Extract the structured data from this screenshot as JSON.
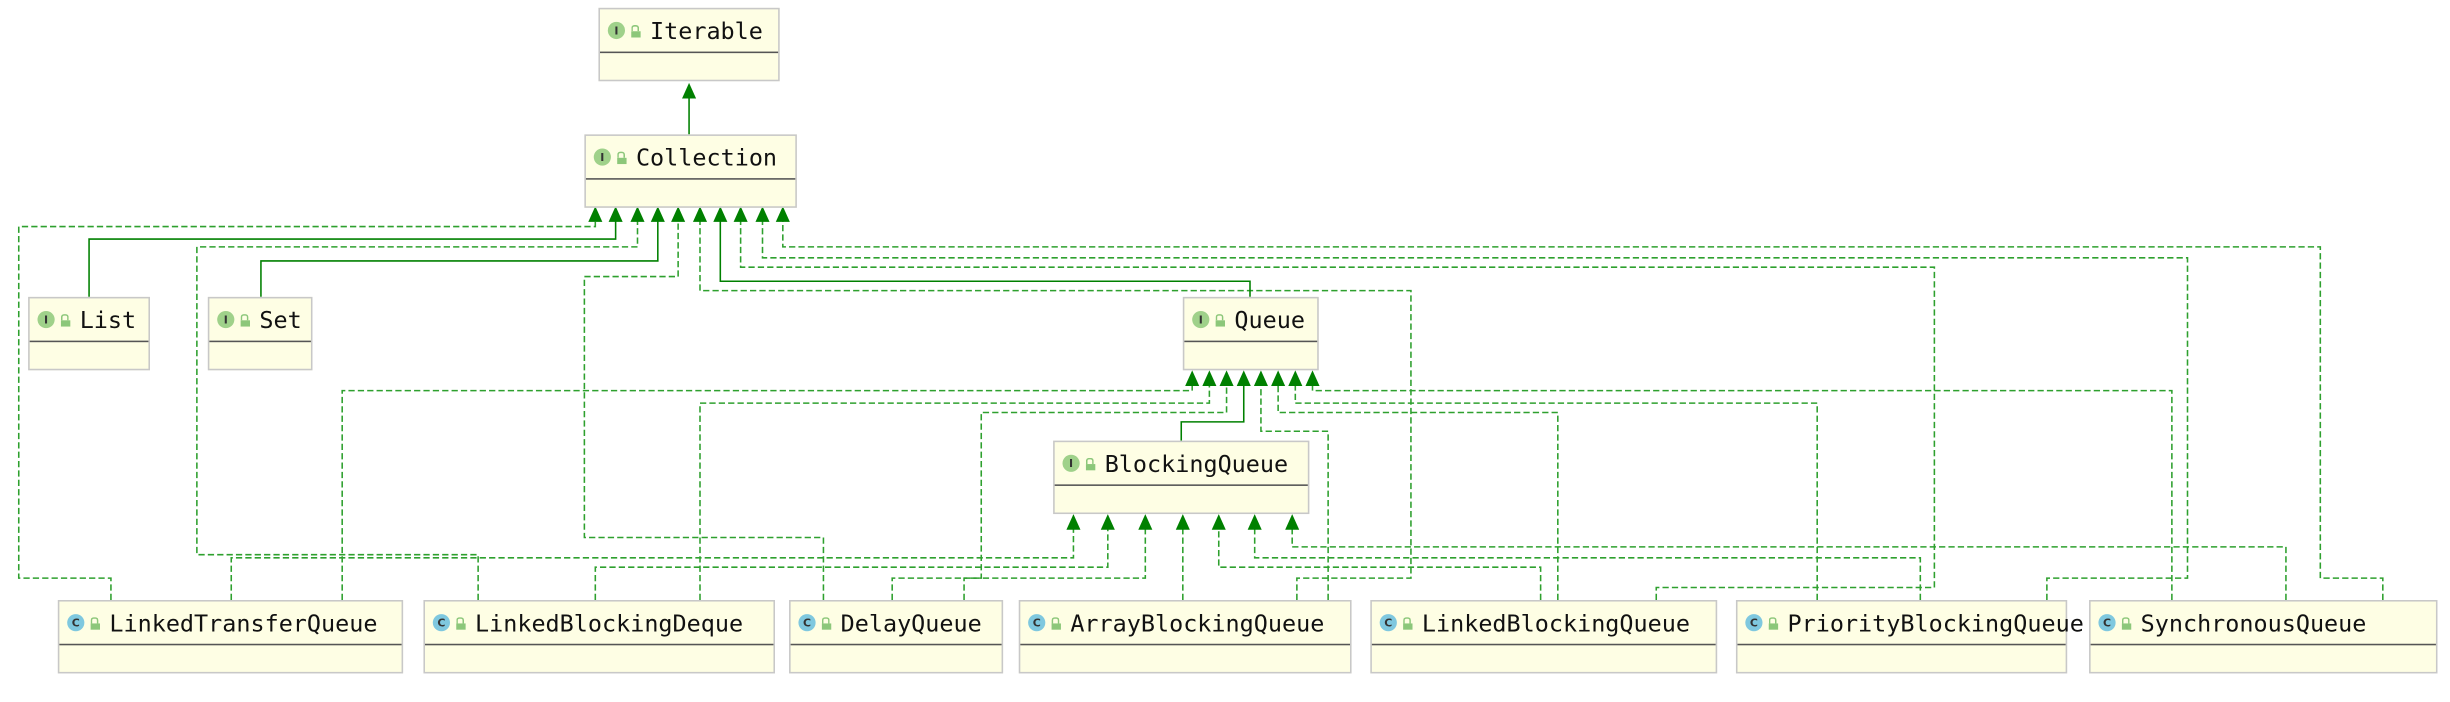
{
  "colors": {
    "edge": "#008000",
    "dashed_edge": "#2ea02e",
    "node_fill": "#fefee4",
    "interface_badge": "#9fd18a",
    "class_badge": "#7fc8df"
  },
  "nodes": {
    "iterable": {
      "name": "Iterable",
      "kind": "interface",
      "badge": "I"
    },
    "collection": {
      "name": "Collection",
      "kind": "interface",
      "badge": "I"
    },
    "list": {
      "name": "List",
      "kind": "interface",
      "badge": "I"
    },
    "set": {
      "name": "Set",
      "kind": "interface",
      "badge": "I"
    },
    "queue": {
      "name": "Queue",
      "kind": "interface",
      "badge": "I"
    },
    "blocking_queue": {
      "name": "BlockingQueue",
      "kind": "interface",
      "badge": "I"
    },
    "linked_transfer_queue": {
      "name": "LinkedTransferQueue",
      "kind": "class",
      "badge": "C"
    },
    "linked_blocking_deque": {
      "name": "LinkedBlockingDeque",
      "kind": "class",
      "badge": "C"
    },
    "delay_queue": {
      "name": "DelayQueue",
      "kind": "class",
      "badge": "C"
    },
    "array_blocking_queue": {
      "name": "ArrayBlockingQueue",
      "kind": "class",
      "badge": "C"
    },
    "linked_blocking_queue": {
      "name": "LinkedBlockingQueue",
      "kind": "class",
      "badge": "C"
    },
    "priority_blocking_queue": {
      "name": "PriorityBlockingQueue",
      "kind": "class",
      "badge": "C"
    },
    "synchronous_queue": {
      "name": "SynchronousQueue",
      "kind": "class",
      "badge": "C"
    }
  },
  "edges": [
    {
      "from": "Collection",
      "to": "Iterable",
      "kind": "extends"
    },
    {
      "from": "LinkedTransferQueue",
      "to": "Collection",
      "kind": "implements"
    },
    {
      "from": "List",
      "to": "Collection",
      "kind": "extends"
    },
    {
      "from": "LinkedBlockingDeque",
      "to": "Collection",
      "kind": "implements"
    },
    {
      "from": "Set",
      "to": "Collection",
      "kind": "extends"
    },
    {
      "from": "DelayQueue",
      "to": "Collection",
      "kind": "implements"
    },
    {
      "from": "ArrayBlockingQueue",
      "to": "Collection",
      "kind": "implements"
    },
    {
      "from": "Queue",
      "to": "Collection",
      "kind": "extends"
    },
    {
      "from": "LinkedBlockingQueue",
      "to": "Collection",
      "kind": "implements"
    },
    {
      "from": "PriorityBlockingQueue",
      "to": "Collection",
      "kind": "implements"
    },
    {
      "from": "SynchronousQueue",
      "to": "Collection",
      "kind": "implements"
    },
    {
      "from": "LinkedTransferQueue",
      "to": "Queue",
      "kind": "implements"
    },
    {
      "from": "LinkedBlockingDeque",
      "to": "Queue",
      "kind": "implements"
    },
    {
      "from": "DelayQueue",
      "to": "Queue",
      "kind": "implements"
    },
    {
      "from": "BlockingQueue",
      "to": "Queue",
      "kind": "extends"
    },
    {
      "from": "ArrayBlockingQueue",
      "to": "Queue",
      "kind": "implements"
    },
    {
      "from": "LinkedBlockingQueue",
      "to": "Queue",
      "kind": "implements"
    },
    {
      "from": "PriorityBlockingQueue",
      "to": "Queue",
      "kind": "implements"
    },
    {
      "from": "SynchronousQueue",
      "to": "Queue",
      "kind": "implements"
    },
    {
      "from": "LinkedTransferQueue",
      "to": "BlockingQueue",
      "kind": "implements"
    },
    {
      "from": "LinkedBlockingDeque",
      "to": "BlockingQueue",
      "kind": "implements"
    },
    {
      "from": "DelayQueue",
      "to": "BlockingQueue",
      "kind": "implements"
    },
    {
      "from": "ArrayBlockingQueue",
      "to": "BlockingQueue",
      "kind": "implements"
    },
    {
      "from": "LinkedBlockingQueue",
      "to": "BlockingQueue",
      "kind": "implements"
    },
    {
      "from": "PriorityBlockingQueue",
      "to": "BlockingQueue",
      "kind": "implements"
    },
    {
      "from": "SynchronousQueue",
      "to": "BlockingQueue",
      "kind": "implements"
    }
  ]
}
